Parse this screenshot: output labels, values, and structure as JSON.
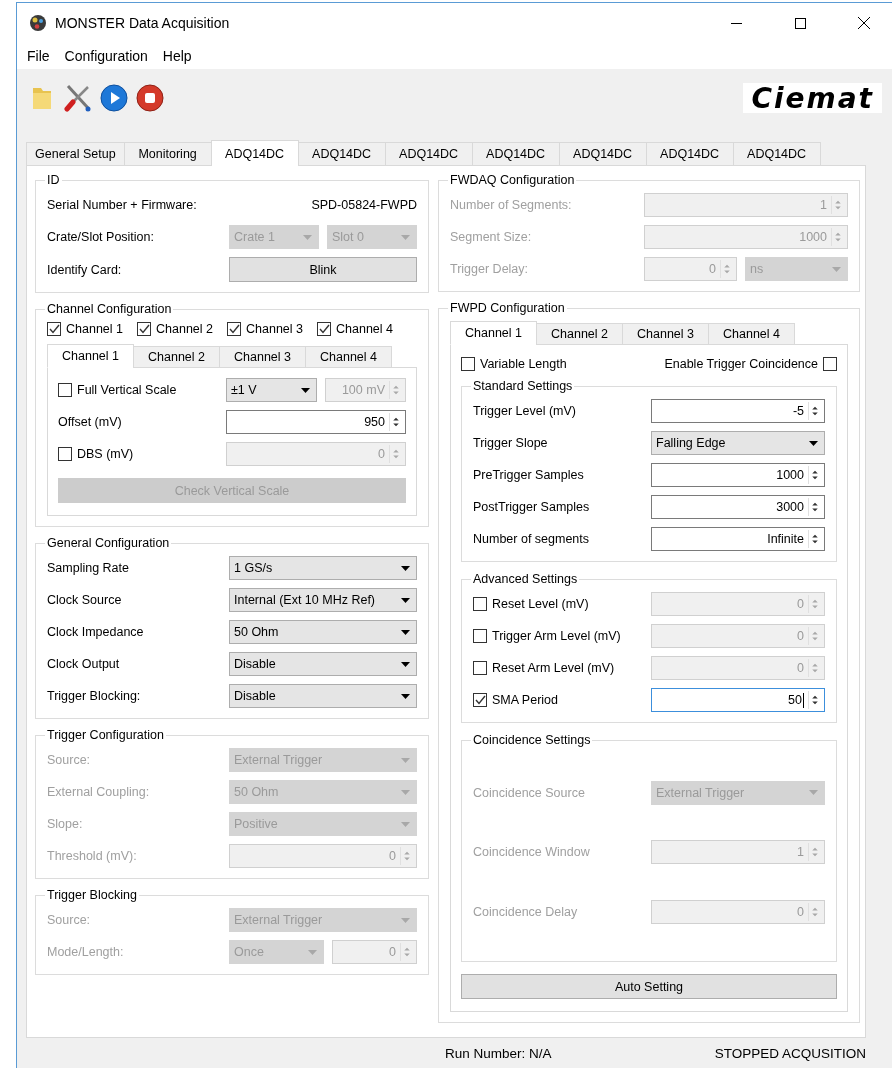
{
  "window": {
    "title": "MONSTER Data Acquisition"
  },
  "menu": [
    "File",
    "Configuration",
    "Help"
  ],
  "toolbar": {
    "logo": "Ciemat"
  },
  "tabs": [
    {
      "label": "General Setup",
      "selected": false
    },
    {
      "label": "Monitoring",
      "selected": false
    },
    {
      "label": "ADQ14DC",
      "selected": true
    },
    {
      "label": "ADQ14DC",
      "selected": false
    },
    {
      "label": "ADQ14DC",
      "selected": false
    },
    {
      "label": "ADQ14DC",
      "selected": false
    },
    {
      "label": "ADQ14DC",
      "selected": false
    },
    {
      "label": "ADQ14DC",
      "selected": false
    },
    {
      "label": "ADQ14DC",
      "selected": false
    }
  ],
  "left_groups": [
    {
      "title": "ID",
      "rows": [
        {
          "kind": "plain",
          "label": "Serial Number + Firmware:",
          "disabled": false,
          "controls": [
            {
              "kind": "text",
              "value": "SPD-05824-FWPD"
            }
          ]
        },
        {
          "kind": "plain",
          "label": "Crate/Slot Position:",
          "disabled": false,
          "controls": [
            {
              "kind": "combo",
              "value": "Crate 1",
              "disabled": true
            },
            {
              "kind": "combo",
              "value": "Slot 0",
              "disabled": true
            }
          ]
        },
        {
          "kind": "plain",
          "label": "Identify Card:",
          "disabled": false,
          "controls": [
            {
              "kind": "button",
              "label": "Blink",
              "disabled": false
            }
          ]
        }
      ]
    },
    {
      "title": "Channel Configuration",
      "checks": [
        {
          "label": "Channel 1",
          "checked": true
        },
        {
          "label": "Channel 2",
          "checked": true
        },
        {
          "label": "Channel 3",
          "checked": true
        },
        {
          "label": "Channel 4",
          "checked": true
        }
      ],
      "tabs": [
        {
          "label": "Channel 1",
          "selected": true
        },
        {
          "label": "Channel 2",
          "selected": false
        },
        {
          "label": "Channel 3",
          "selected": false
        },
        {
          "label": "Channel 4",
          "selected": false
        }
      ],
      "panel": {
        "rows": [
          {
            "kind": "check",
            "label": "Full Vertical Scale",
            "checked": false,
            "disabled": false,
            "controls": [
              {
                "kind": "combo",
                "value": "±1 V",
                "disabled": false
              },
              {
                "kind": "spin",
                "value": "100 mV",
                "disabled": true,
                "focused": false
              }
            ]
          },
          {
            "kind": "plain",
            "label": "Offset (mV)",
            "disabled": false,
            "controls": [
              {
                "kind": "spin",
                "value": "950",
                "disabled": false,
                "focused": false
              }
            ]
          },
          {
            "kind": "check",
            "label": "DBS (mV)",
            "checked": false,
            "disabled": false,
            "controls": [
              {
                "kind": "spin",
                "value": "0",
                "disabled": true,
                "focused": false
              }
            ]
          }
        ],
        "button": {
          "label": "Check Vertical Scale",
          "disabled": true
        }
      }
    },
    {
      "title": "General Configuration",
      "rows": [
        {
          "kind": "plain",
          "label": "Sampling Rate",
          "disabled": false,
          "controls": [
            {
              "kind": "combo",
              "value": "1 GS/s",
              "disabled": false
            }
          ]
        },
        {
          "kind": "plain",
          "label": "Clock Source",
          "disabled": false,
          "controls": [
            {
              "kind": "combo",
              "value": "Internal (Ext 10 MHz Ref)",
              "disabled": false
            }
          ]
        },
        {
          "kind": "plain",
          "label": "Clock Impedance",
          "disabled": false,
          "controls": [
            {
              "kind": "combo",
              "value": "50 Ohm",
              "disabled": false
            }
          ]
        },
        {
          "kind": "plain",
          "label": "Clock Output",
          "disabled": false,
          "controls": [
            {
              "kind": "combo",
              "value": "Disable",
              "disabled": false
            }
          ]
        },
        {
          "kind": "plain",
          "label": "Trigger Blocking:",
          "disabled": false,
          "controls": [
            {
              "kind": "combo",
              "value": "Disable",
              "disabled": false
            }
          ]
        }
      ]
    },
    {
      "title": "Trigger Configuration",
      "rows": [
        {
          "kind": "plain",
          "label": "Source:",
          "disabled": true,
          "controls": [
            {
              "kind": "combo",
              "value": "External Trigger",
              "disabled": true
            }
          ]
        },
        {
          "kind": "plain",
          "label": "External Coupling:",
          "disabled": true,
          "controls": [
            {
              "kind": "combo",
              "value": "50 Ohm",
              "disabled": true
            }
          ]
        },
        {
          "kind": "plain",
          "label": "Slope:",
          "disabled": true,
          "controls": [
            {
              "kind": "combo",
              "value": "Positive",
              "disabled": true
            }
          ]
        },
        {
          "kind": "plain",
          "label": "Threshold (mV):",
          "disabled": true,
          "controls": [
            {
              "kind": "spin",
              "value": "0",
              "disabled": true,
              "focused": false
            }
          ]
        }
      ]
    },
    {
      "title": "Trigger Blocking",
      "rows": [
        {
          "kind": "plain",
          "label": "Source:",
          "disabled": true,
          "controls": [
            {
              "kind": "combo",
              "value": "External Trigger",
              "disabled": true
            }
          ]
        },
        {
          "kind": "plain",
          "label": "Mode/Length:",
          "disabled": true,
          "controls": [
            {
              "kind": "combo",
              "value": "Once",
              "disabled": true
            },
            {
              "kind": "spin",
              "value": "0",
              "disabled": true,
              "focused": false
            }
          ]
        }
      ]
    }
  ],
  "right_groups": [
    {
      "title": "FWDAQ Configuration",
      "rows": [
        {
          "kind": "plain",
          "label": "Number of Segments:",
          "disabled": true,
          "controls": [
            {
              "kind": "spin",
              "value": "1",
              "disabled": true,
              "focused": false
            }
          ]
        },
        {
          "kind": "plain",
          "label": "Segment Size:",
          "disabled": true,
          "controls": [
            {
              "kind": "spin",
              "value": "1000",
              "disabled": true,
              "focused": false
            }
          ]
        },
        {
          "kind": "plain",
          "label": "Trigger Delay:",
          "disabled": true,
          "controls": [
            {
              "kind": "spin",
              "value": "0",
              "disabled": true,
              "focused": false
            },
            {
              "kind": "combo",
              "value": "ns",
              "disabled": true
            }
          ]
        }
      ]
    },
    {
      "title": "FWPD Configuration",
      "tabs": [
        {
          "label": "Channel 1",
          "selected": true
        },
        {
          "label": "Channel 2",
          "selected": false
        },
        {
          "label": "Channel 3",
          "selected": false
        },
        {
          "label": "Channel 4",
          "selected": false
        }
      ],
      "panel": {
        "options": [
          {
            "kind": "box-left",
            "label": "Variable Length",
            "checked": false
          },
          {
            "kind": "box-right",
            "label": "Enable Trigger Coincidence",
            "checked": false
          }
        ],
        "groups": [
          {
            "title": "Standard Settings",
            "rows": [
              {
                "kind": "plain",
                "label": "Trigger Level (mV)",
                "disabled": false,
                "controls": [
                  {
                    "kind": "spin",
                    "value": "-5",
                    "disabled": false,
                    "focused": false
                  }
                ]
              },
              {
                "kind": "plain",
                "label": "Trigger Slope",
                "disabled": false,
                "controls": [
                  {
                    "kind": "combo",
                    "value": "Falling Edge",
                    "disabled": false
                  }
                ]
              },
              {
                "kind": "plain",
                "label": "PreTrigger Samples",
                "disabled": false,
                "controls": [
                  {
                    "kind": "spin",
                    "value": "1000",
                    "disabled": false,
                    "focused": false
                  }
                ]
              },
              {
                "kind": "plain",
                "label": "PostTrigger Samples",
                "disabled": false,
                "controls": [
                  {
                    "kind": "spin",
                    "value": "3000",
                    "disabled": false,
                    "focused": false
                  }
                ]
              },
              {
                "kind": "plain",
                "label": "Number of segments",
                "disabled": false,
                "controls": [
                  {
                    "kind": "spin",
                    "value": "Infinite",
                    "disabled": false,
                    "focused": false
                  }
                ]
              }
            ]
          },
          {
            "title": "Advanced Settings",
            "rows": [
              {
                "kind": "check",
                "label": "Reset Level (mV)",
                "checked": false,
                "disabled": false,
                "controls": [
                  {
                    "kind": "spin",
                    "value": "0",
                    "disabled": true,
                    "focused": false
                  }
                ]
              },
              {
                "kind": "check",
                "label": "Trigger Arm Level (mV)",
                "checked": false,
                "disabled": false,
                "controls": [
                  {
                    "kind": "spin",
                    "value": "0",
                    "disabled": true,
                    "focused": false
                  }
                ]
              },
              {
                "kind": "check",
                "label": "Reset Arm Level (mV)",
                "checked": false,
                "disabled": false,
                "controls": [
                  {
                    "kind": "spin",
                    "value": "0",
                    "disabled": true,
                    "focused": false
                  }
                ]
              },
              {
                "kind": "check",
                "label": "SMA Period",
                "checked": true,
                "disabled": false,
                "controls": [
                  {
                    "kind": "spin",
                    "value": "50",
                    "disabled": false,
                    "focused": true
                  }
                ]
              }
            ]
          },
          {
            "title": "Coincidence Settings",
            "rows": [
              {
                "kind": "plain",
                "label": "Coincidence Source",
                "disabled": true,
                "controls": [
                  {
                    "kind": "combo",
                    "value": "External Trigger",
                    "disabled": true
                  }
                ]
              },
              {
                "kind": "plain",
                "label": "Coincidence Window",
                "disabled": true,
                "controls": [
                  {
                    "kind": "spin",
                    "value": "1",
                    "disabled": true,
                    "focused": false
                  }
                ]
              },
              {
                "kind": "plain",
                "label": "Coincidence Delay",
                "disabled": true,
                "controls": [
                  {
                    "kind": "spin",
                    "value": "0",
                    "disabled": true,
                    "focused": false
                  }
                ]
              }
            ]
          }
        ],
        "button": {
          "label": "Auto Setting",
          "disabled": false
        }
      }
    }
  ],
  "status_bar": {
    "run_number": "Run Number: N/A",
    "acquisition": "STOPPED ACQUSITION"
  }
}
